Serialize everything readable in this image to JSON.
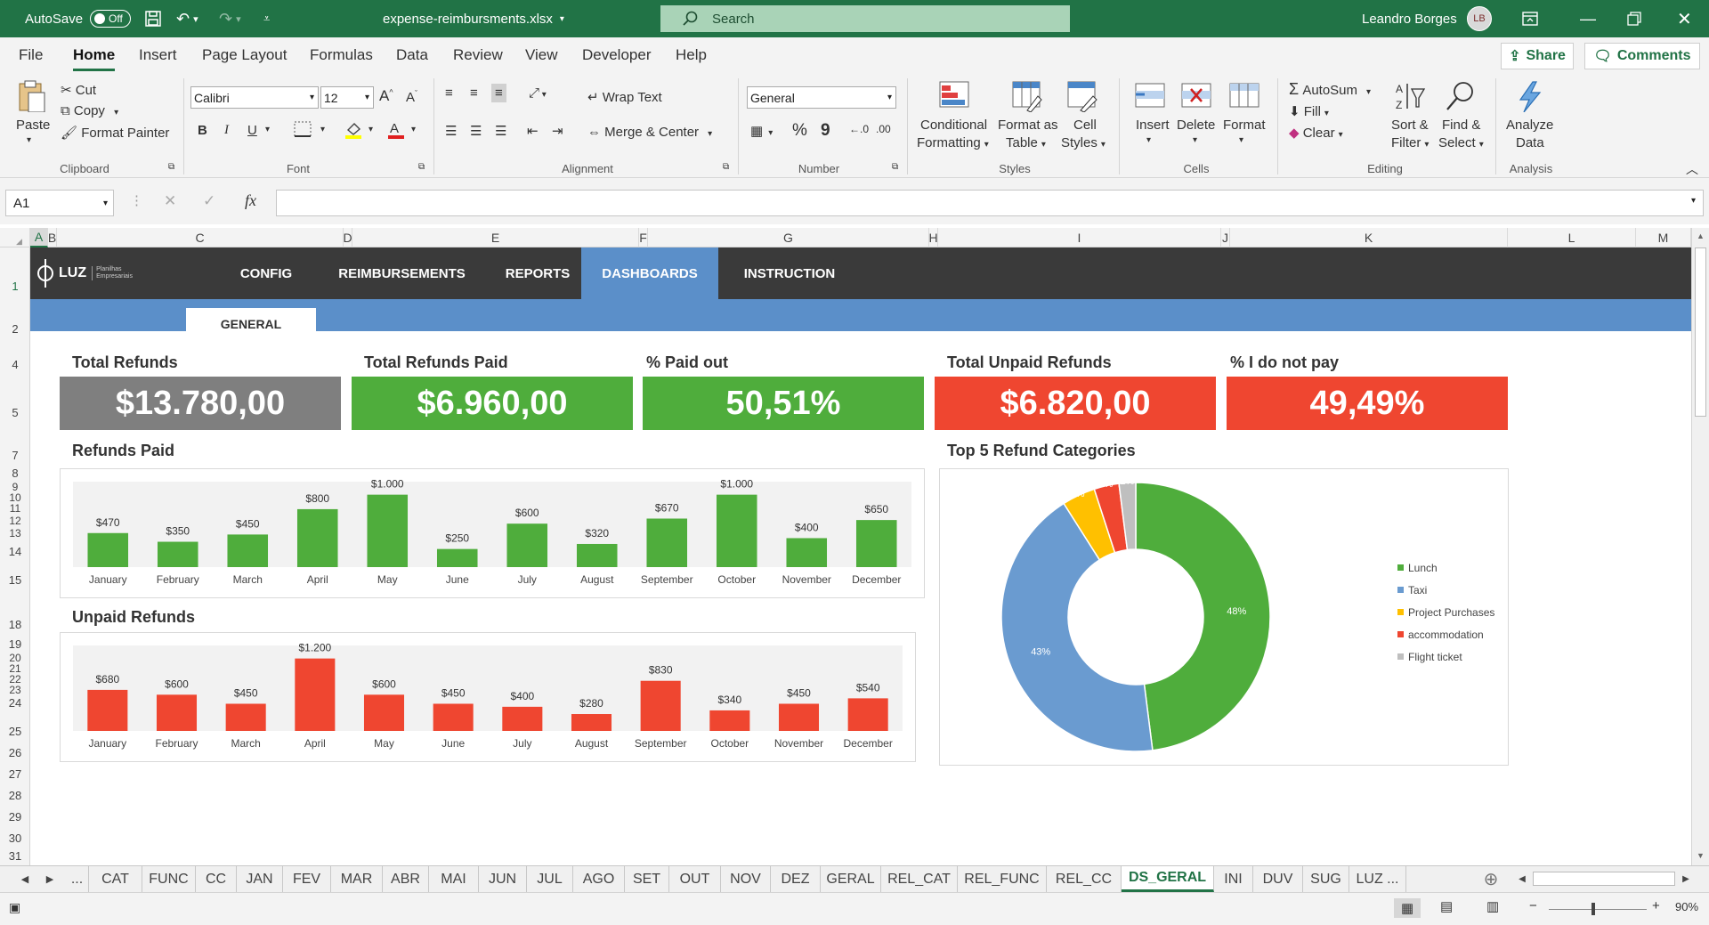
{
  "titlebar": {
    "autosave_label": "AutoSave",
    "autosave_state": "Off",
    "filename": "expense-reimbursments.xlsx",
    "search_placeholder": "Search",
    "user_name": "Leandro Borges",
    "user_initials": "LB"
  },
  "menu": {
    "tabs": [
      "File",
      "Home",
      "Insert",
      "Page Layout",
      "Formulas",
      "Data",
      "Review",
      "View",
      "Developer",
      "Help"
    ],
    "active": "Home",
    "share_label": "Share",
    "comments_label": "Comments"
  },
  "ribbon": {
    "clipboard": {
      "paste": "Paste",
      "cut": "Cut",
      "copy": "Copy",
      "format_painter": "Format Painter",
      "label": "Clipboard"
    },
    "font": {
      "name": "Calibri",
      "size": "12",
      "label": "Font",
      "bold": "B",
      "italic": "I",
      "underline": "U"
    },
    "alignment": {
      "wrap_text": "Wrap Text",
      "merge_center": "Merge & Center",
      "label": "Alignment"
    },
    "number": {
      "format": "General",
      "percent": "%",
      "comma": "9",
      "label": "Number"
    },
    "styles": {
      "conditional": "Conditional",
      "conditional2": "Formatting",
      "format_table": "Format as",
      "format_table2": "Table",
      "cell_styles": "Cell",
      "cell_styles2": "Styles",
      "label": "Styles"
    },
    "cells": {
      "insert": "Insert",
      "delete": "Delete",
      "format": "Format",
      "label": "Cells"
    },
    "editing": {
      "autosum": "AutoSum",
      "fill": "Fill",
      "clear": "Clear",
      "sort": "Sort &",
      "sort2": "Filter",
      "find": "Find &",
      "find2": "Select",
      "label": "Editing"
    },
    "analysis": {
      "analyze": "Analyze",
      "analyze2": "Data",
      "label": "Analysis"
    }
  },
  "formula_bar": {
    "name_box": "A1",
    "fx": "fx",
    "value": ""
  },
  "columns": [
    "A",
    "B",
    "C",
    "D",
    "E",
    "F",
    "G",
    "H",
    "I",
    "J",
    "K",
    "L",
    "M"
  ],
  "rows": [
    "1",
    "2",
    "4",
    "5",
    "7",
    "8",
    "9",
    "10",
    "11",
    "12",
    "13",
    "14",
    "15",
    "18",
    "19",
    "20",
    "21",
    "22",
    "23",
    "24",
    "25",
    "26",
    "27",
    "28",
    "29",
    "30",
    "31"
  ],
  "dashboard": {
    "logo_text": "LUZ",
    "logo_sub1": "Planilhas",
    "logo_sub2": "Empresariais",
    "nav": [
      "CONFIG",
      "REIMBURSEMENTS",
      "REPORTS",
      "DASHBOARDS",
      "INSTRUCTION"
    ],
    "nav_active": "DASHBOARDS",
    "subtab": "GENERAL",
    "kpis": [
      {
        "title": "Total Refunds",
        "value": "$13.780,00",
        "color": "#7f7f7f"
      },
      {
        "title": "Total Refunds Paid",
        "value": "$6.960,00",
        "color": "#4fad3c"
      },
      {
        "title": "% Paid out",
        "value": "50,51%",
        "color": "#4fad3c"
      },
      {
        "title": "Total Unpaid Refunds",
        "value": "$6.820,00",
        "color": "#ef4630"
      },
      {
        "title": "% I do not pay",
        "value": "49,49%",
        "color": "#ef4630"
      }
    ],
    "paid_title": "Refunds Paid",
    "unpaid_title": "Unpaid Refunds",
    "pie_title": "Top 5 Refund Categories"
  },
  "chart_data": [
    {
      "type": "bar",
      "title": "Refunds Paid",
      "color": "#4fad3c",
      "categories": [
        "January",
        "February",
        "March",
        "April",
        "May",
        "June",
        "July",
        "August",
        "September",
        "October",
        "November",
        "December"
      ],
      "values": [
        470,
        350,
        450,
        800,
        1000,
        250,
        600,
        320,
        670,
        1000,
        400,
        650
      ],
      "labels": [
        "$470",
        "$350",
        "$450",
        "$800",
        "$1.000",
        "$250",
        "$600",
        "$320",
        "$670",
        "$1.000",
        "$400",
        "$650"
      ],
      "ylim": [
        0,
        1000
      ]
    },
    {
      "type": "bar",
      "title": "Unpaid Refunds",
      "color": "#ef4630",
      "categories": [
        "January",
        "February",
        "March",
        "April",
        "May",
        "June",
        "July",
        "August",
        "September",
        "October",
        "November",
        "December"
      ],
      "values": [
        680,
        600,
        450,
        1200,
        600,
        450,
        400,
        280,
        830,
        340,
        450,
        540
      ],
      "labels": [
        "$680",
        "$600",
        "$450",
        "$1.200",
        "$600",
        "$450",
        "$400",
        "$280",
        "$830",
        "$340",
        "$450",
        "$540"
      ],
      "ylim": [
        0,
        1200
      ]
    },
    {
      "type": "pie",
      "title": "Top 5 Refund Categories",
      "categories": [
        "Lunch",
        "Taxi",
        "Project Purchases",
        "accommodation",
        "Flight ticket"
      ],
      "values": [
        48,
        43,
        4,
        3,
        2
      ],
      "labels": [
        "48%",
        "43%",
        "4%",
        "3%",
        "2%"
      ],
      "colors": [
        "#4fad3c",
        "#6a9bd0",
        "#ffc000",
        "#ef4630",
        "#bfbfbf"
      ],
      "legend": "right"
    }
  ],
  "sheet_tabs": [
    "...",
    "CAT",
    "FUNC",
    "CC",
    "JAN",
    "FEV",
    "MAR",
    "ABR",
    "MAI",
    "JUN",
    "JUL",
    "AGO",
    "SET",
    "OUT",
    "NOV",
    "DEZ",
    "GERAL",
    "REL_CAT",
    "REL_FUNC",
    "REL_CC",
    "DS_GERAL",
    "INI",
    "DUV",
    "SUG",
    "LUZ ..."
  ],
  "active_sheet": "DS_GERAL",
  "status": {
    "zoom": "90%"
  }
}
